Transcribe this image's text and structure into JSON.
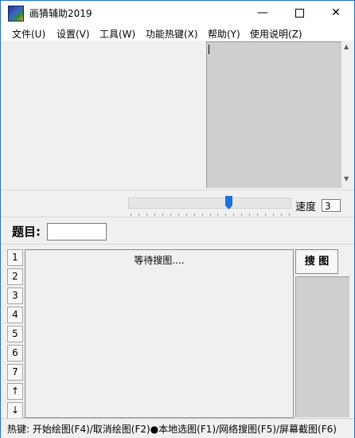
{
  "window": {
    "title": "画猜辅助2019"
  },
  "window_controls": {
    "minimize": "—",
    "close": "✕"
  },
  "menu": [
    "文件(U)",
    "设置(V)",
    "工具(W)",
    "功能热键(X)",
    "帮助(Y)",
    "使用说明(Z)"
  ],
  "speed": {
    "label": "速度",
    "value": "3"
  },
  "topic": {
    "label": "题目:"
  },
  "number_buttons": [
    "1",
    "2",
    "3",
    "4",
    "5",
    "6",
    "7",
    "↑",
    "↓"
  ],
  "answer": {
    "text": "等待搜图...."
  },
  "search_button": "搜 图",
  "status": {
    "text": "热键: 开始绘图(F4)/取消绘图(F2)●本地选图(F1)/网络搜图(F5)/屏幕截图(F6)"
  },
  "icons": {
    "app": "app-logo-icon",
    "scroll_up": "▲",
    "scroll_down": "▼"
  },
  "colors": {
    "window_border": "#1f6fd1",
    "slider_thumb": "#1a73d9",
    "preview_bg": "#cfcfcf"
  },
  "slider": {
    "fraction": 0.62
  }
}
